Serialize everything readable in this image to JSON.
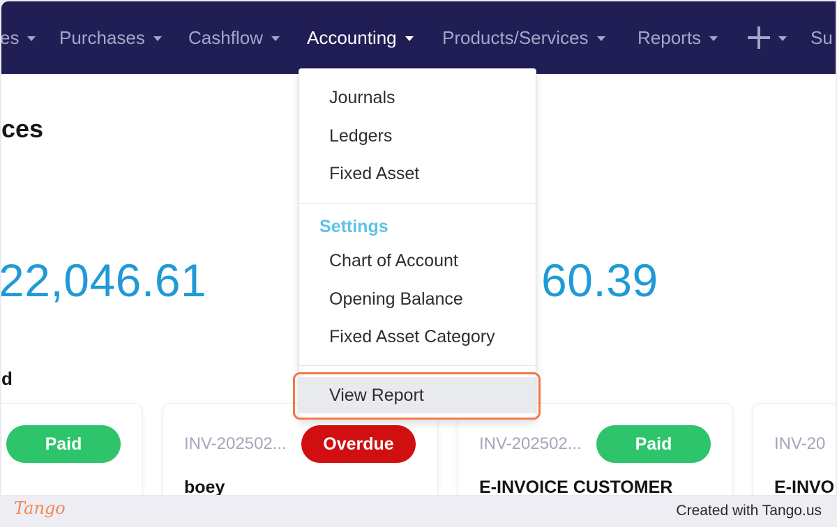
{
  "nav": {
    "items": [
      {
        "label": "es",
        "active": false
      },
      {
        "label": "Purchases",
        "active": false
      },
      {
        "label": "Cashflow",
        "active": false
      },
      {
        "label": "Accounting",
        "active": true
      },
      {
        "label": "Products/Services",
        "active": false
      },
      {
        "label": "Reports",
        "active": false
      },
      {
        "label": "Su",
        "active": false
      }
    ],
    "add_icon": "plus-icon"
  },
  "page": {
    "title": "ces",
    "stats": [
      {
        "value": "22,046.61"
      },
      {
        "value": "60.39"
      }
    ],
    "section_label": "d"
  },
  "invoices": [
    {
      "number": "",
      "status": "Paid",
      "status_color": "#2ec46b",
      "customer": ""
    },
    {
      "number": "INV-202502...",
      "status": "Overdue",
      "status_color": "#d10f10",
      "customer": "boey"
    },
    {
      "number": "INV-202502...",
      "status": "Paid",
      "status_color": "#2ec46b",
      "customer": "E-INVOICE CUSTOMER"
    },
    {
      "number": "INV-20",
      "status": "",
      "status_color": "",
      "customer": "E-INVO"
    }
  ],
  "dropdown": {
    "items": [
      {
        "label": "Journals"
      },
      {
        "label": "Ledgers"
      },
      {
        "label": "Fixed Asset"
      }
    ],
    "settings_header": "Settings",
    "settings_items": [
      {
        "label": "Chart of Account"
      },
      {
        "label": "Opening Balance"
      },
      {
        "label": "Fixed Asset Category"
      }
    ],
    "report_item": {
      "label": "View Report"
    }
  },
  "colors": {
    "navbar": "#211d55",
    "accent_blue": "#1f9ad6",
    "settings_header": "#5ec2e6",
    "highlight": "#f07848"
  },
  "footer": {
    "logo": "Tango",
    "credit": "Created with Tango.us"
  }
}
